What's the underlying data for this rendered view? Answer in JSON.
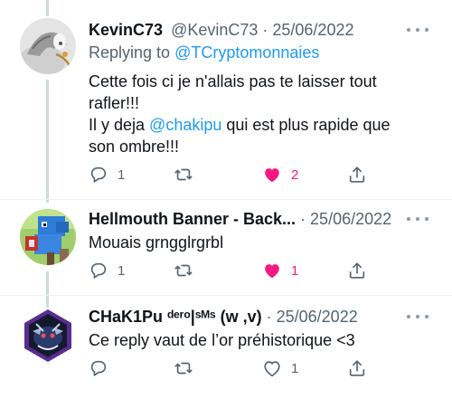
{
  "tweets": [
    {
      "name": "KevinC73",
      "handle": "@KevinC73",
      "sep": " · ",
      "date": "25/06/2022",
      "replying_label": "Replying to ",
      "replying_to": "@TCryptomonnaies",
      "lines": [
        {
          "text": "Cette fois ci je n'allais pas te laisser tout"
        },
        {
          "text": "rafler!!!"
        },
        {
          "pre": "Il y deja ",
          "mention": "@chakipu",
          "post": " qui est plus rapide que"
        },
        {
          "text": "son ombre!!!"
        }
      ],
      "replies": "1",
      "likes": "2",
      "liked": true
    },
    {
      "name": "Hellmouth Banner - Back...",
      "handle": "",
      "sep": " · ",
      "date": "25/06/2022",
      "text": "Mouais grngglrgrbl",
      "replies": "1",
      "likes": "1",
      "liked": true
    },
    {
      "name": "CHaK1Pu ᵈᵉʳᵒ|ˢᴹˢ (w ,v)",
      "handle": "",
      "sep": " · ",
      "date": "25/06/2022",
      "text": "Ce reply vaut de l’or préhistorique <3",
      "replies": "",
      "likes": "1",
      "liked": false
    }
  ],
  "icons": {
    "reply": "reply-icon",
    "retweet": "retweet-icon",
    "like": "heart-icon",
    "share": "share-icon",
    "more": "more-icon"
  },
  "colors": {
    "accent": "#1d9bf0",
    "like": "#f91880",
    "muted": "#536471",
    "thread_line": "#cfd9de"
  }
}
